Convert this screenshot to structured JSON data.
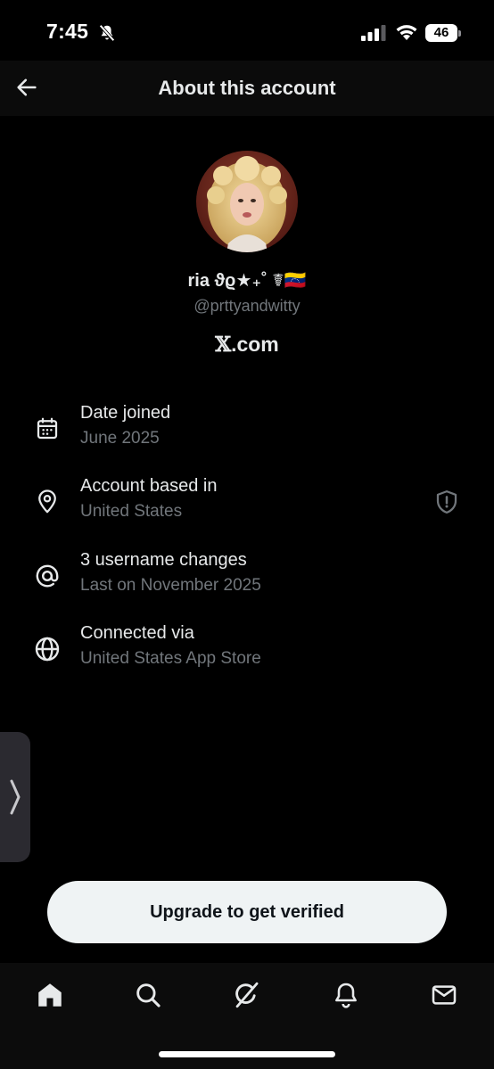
{
  "status_bar": {
    "time": "7:45",
    "battery_level": "46",
    "icons": [
      "bell-slash-icon",
      "cellular-signal-icon",
      "wifi-icon",
      "battery-icon"
    ]
  },
  "header": {
    "title": "About this account",
    "back_icon": "arrow-left-icon"
  },
  "profile": {
    "display_name": "ria ϑϱ★₊˚ ☤🇻🇪",
    "handle": "@prttyandwitty",
    "site_x": "𝕏",
    "site_rest": ".com"
  },
  "info_rows": [
    {
      "icon": "calendar-icon",
      "title": "Date joined",
      "subtitle": "June 2025"
    },
    {
      "icon": "location-pin-icon",
      "title": "Account based in",
      "subtitle": "United States",
      "trailing_icon": "shield-exclamation-icon"
    },
    {
      "icon": "at-sign-icon",
      "title": "3 username changes",
      "subtitle": "Last on November 2025"
    },
    {
      "icon": "globe-icon",
      "title": "Connected via",
      "subtitle": "United States App Store"
    }
  ],
  "upgrade": {
    "label": "Upgrade to get verified"
  },
  "bottom_nav": [
    "home-icon",
    "search-icon",
    "grok-icon",
    "notifications-bell-icon",
    "messages-envelope-icon"
  ],
  "colors": {
    "background": "#000000",
    "primary_text": "#e7e9ea",
    "secondary_text": "#71767b",
    "button_bg": "#eff3f4"
  }
}
